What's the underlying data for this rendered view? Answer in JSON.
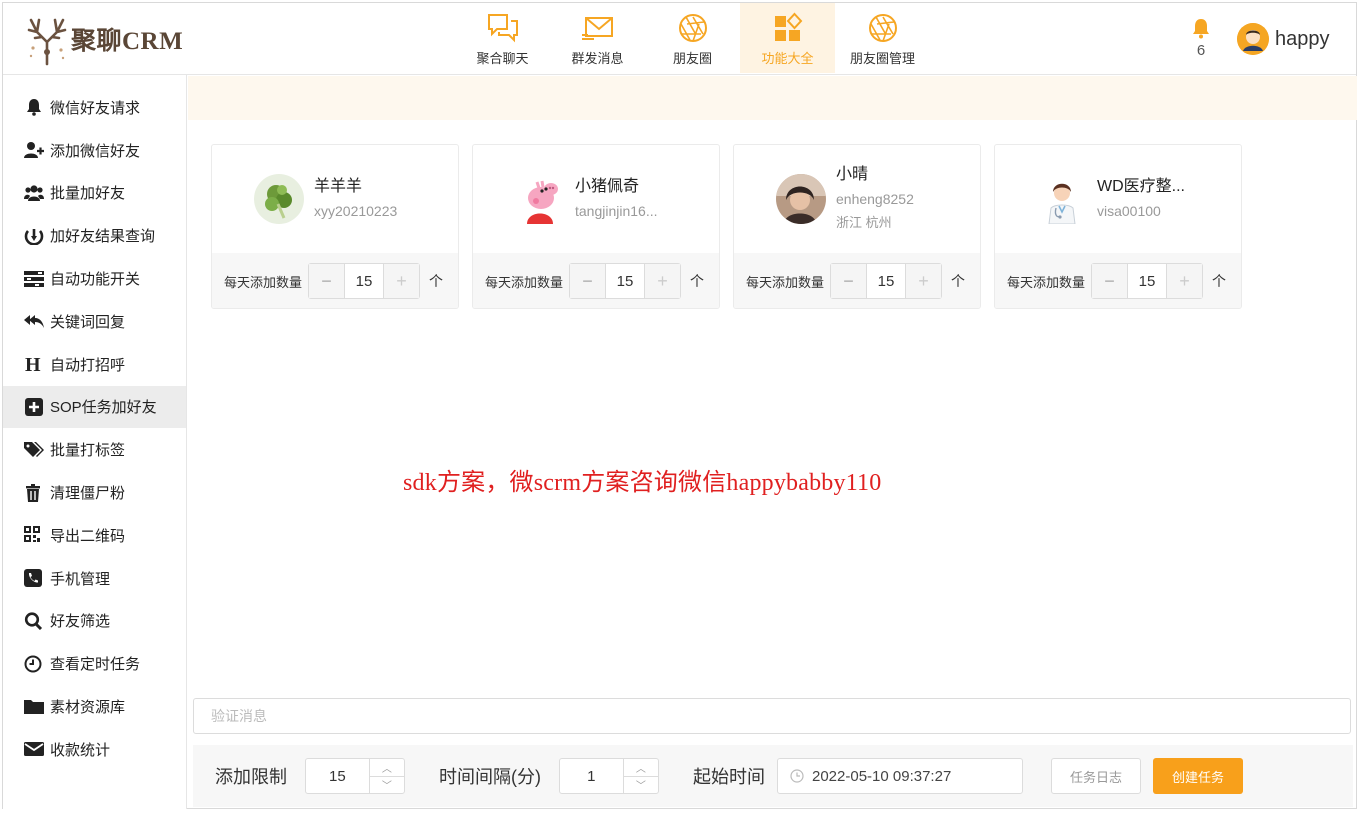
{
  "app": {
    "logo_text": "聚聊CRM"
  },
  "topnav": [
    {
      "label": "聚合聊天",
      "icon": "chat-bubbles-icon",
      "active": false
    },
    {
      "label": "群发消息",
      "icon": "envelope-icon",
      "active": false
    },
    {
      "label": "朋友圈",
      "icon": "aperture-icon",
      "active": false
    },
    {
      "label": "功能大全",
      "icon": "feature-grid-icon",
      "active": true
    },
    {
      "label": "朋友圈管理",
      "icon": "aperture-icon",
      "active": false
    }
  ],
  "header": {
    "notification_count": "6",
    "username": "happy"
  },
  "sidebar": {
    "items": [
      {
        "label": "微信好友请求",
        "icon": "bell-icon"
      },
      {
        "label": "添加微信好友",
        "icon": "add-user-icon"
      },
      {
        "label": "批量加好友",
        "icon": "users-icon"
      },
      {
        "label": "加好友结果查询",
        "icon": "result-query-icon"
      },
      {
        "label": "自动功能开关",
        "icon": "toggles-icon"
      },
      {
        "label": "关键词回复",
        "icon": "reply-all-icon"
      },
      {
        "label": "自动打招呼",
        "icon": "header-h-icon"
      },
      {
        "label": "SOP任务加好友",
        "icon": "plus-square-icon",
        "active": true
      },
      {
        "label": "批量打标签",
        "icon": "tags-icon"
      },
      {
        "label": "清理僵尸粉",
        "icon": "trash-icon"
      },
      {
        "label": "导出二维码",
        "icon": "qrcode-icon"
      },
      {
        "label": "手机管理",
        "icon": "phone-icon"
      },
      {
        "label": "好友筛选",
        "icon": "search-icon"
      },
      {
        "label": "查看定时任务",
        "icon": "clock-icon"
      },
      {
        "label": "素材资源库",
        "icon": "folder-icon"
      },
      {
        "label": "收款统计",
        "icon": "envelope-icon"
      }
    ]
  },
  "cards": [
    {
      "name": "羊羊羊",
      "wxid": "xyy20210223",
      "location": "",
      "daily_label": "每天添加数量",
      "daily_value": "15",
      "unit": "个",
      "avatar": "plant-avatar"
    },
    {
      "name": "小猪佩奇",
      "wxid": "tangjinjin16...",
      "location": "",
      "daily_label": "每天添加数量",
      "daily_value": "15",
      "unit": "个",
      "avatar": "peppa-avatar"
    },
    {
      "name": "小晴",
      "wxid": "enheng8252",
      "location": "浙江 杭州",
      "daily_label": "每天添加数量",
      "daily_value": "15",
      "unit": "个",
      "avatar": "photo-avatar"
    },
    {
      "name": "WD医疗整...",
      "wxid": "visa00100",
      "location": "",
      "daily_label": "每天添加数量",
      "daily_value": "15",
      "unit": "个",
      "avatar": "doctor-avatar"
    }
  ],
  "watermark": "sdk方案，微scrm方案咨询微信happybabby110",
  "verify": {
    "placeholder": "验证消息"
  },
  "footer": {
    "add_limit_label": "添加限制",
    "add_limit_value": "15",
    "interval_label": "时间间隔(分)",
    "interval_value": "1",
    "start_label": "起始时间",
    "start_value": "2022-05-10 09:37:27",
    "log_button": "任务日志",
    "create_button": "创建任务"
  },
  "colors": {
    "accent": "#f8a01b",
    "active_bg": "#fef3e2",
    "banner_bg": "#fef8ee",
    "watermark": "#e02020"
  }
}
